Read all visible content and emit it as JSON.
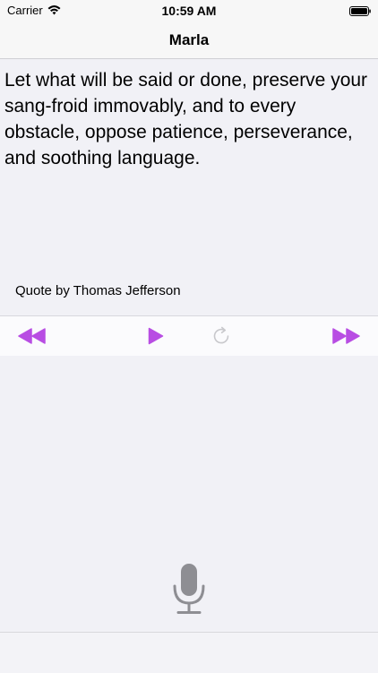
{
  "status_bar": {
    "carrier": "Carrier",
    "time": "10:59 AM"
  },
  "nav": {
    "title": "Marla"
  },
  "quote": {
    "text": " Let what will be said or done, preserve your sang-froid immovably, and to every obstacle, oppose patience, perseverance, and soothing language.",
    "author": "Quote by Thomas Jefferson"
  },
  "controls": {
    "icons": [
      "rewind-icon",
      "play-icon",
      "refresh-icon",
      "fast-forward-icon"
    ]
  },
  "colors": {
    "accent": "#b84de3",
    "disabled": "#c8c8cc",
    "mic": "#8e8e93"
  }
}
